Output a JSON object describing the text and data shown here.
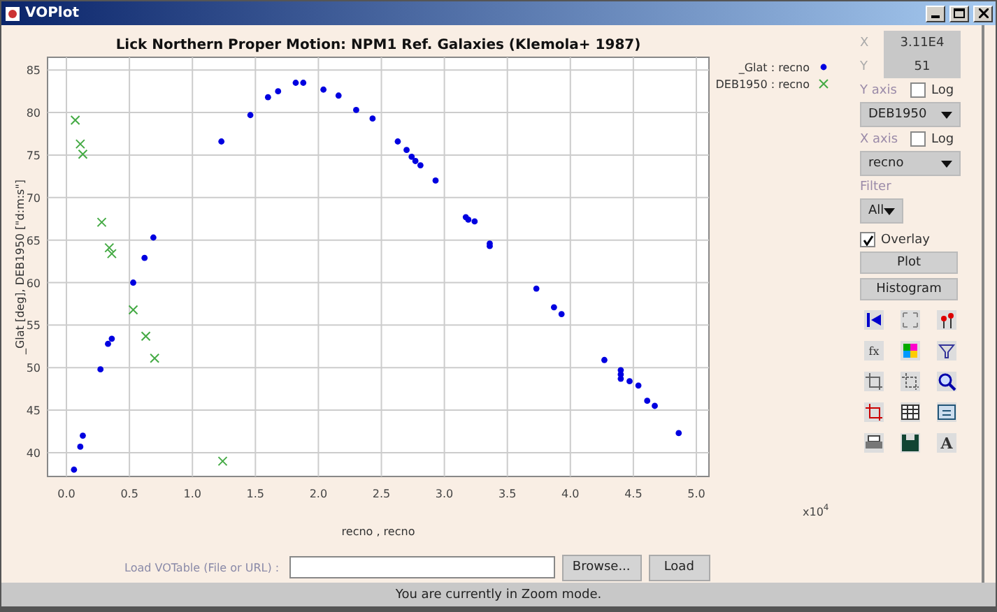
{
  "window": {
    "title": "VOPlot"
  },
  "chart": {
    "chart_data": {
      "type": "scatter",
      "title": "Lick Northern Proper Motion: NPM1 Ref. Galaxies (Klemola+ 1987)",
      "xlabel": "recno , recno",
      "ylabel": "_Glat [deg], DEB1950 [\"d:m:s\"]",
      "xlim": [
        -0.15,
        5.1
      ],
      "ylim": [
        37.2,
        86.5
      ],
      "grid": true,
      "legend": true,
      "xticks": [
        {
          "value": 0,
          "label": "0.0"
        },
        {
          "value": 0.5,
          "label": "0.5"
        },
        {
          "value": 1,
          "label": "1.0"
        },
        1.5,
        {
          "value": 2,
          "label": "2.0"
        },
        2.5,
        {
          "value": 3,
          "label": "3.0"
        },
        3.5,
        {
          "value": 4,
          "label": "4.0"
        },
        4.5,
        {
          "value": 5,
          "label": "5.0"
        }
      ],
      "yticks": [
        40,
        45,
        50,
        55,
        60,
        65,
        70,
        75,
        80,
        85
      ],
      "series": [
        {
          "name": "_Glat : recno",
          "color": "#0000e0",
          "x": [
            0.06,
            0.11,
            0.13,
            0.27,
            0.33,
            0.36,
            0.53,
            0.62,
            0.69,
            1.23,
            1.46,
            1.6,
            1.68,
            1.82,
            1.88,
            2.04,
            2.16,
            2.3,
            2.43,
            2.63,
            2.7,
            2.74,
            2.77,
            2.81,
            2.93,
            3.17,
            3.19,
            3.24,
            3.36,
            3.36,
            3.73,
            3.87,
            3.93,
            4.27,
            4.4,
            4.4,
            4.4,
            4.47,
            4.54,
            4.61,
            4.67,
            4.86
          ],
          "values": [
            38.0,
            40.7,
            42.0,
            49.8,
            52.8,
            53.4,
            60.0,
            62.9,
            65.3,
            76.6,
            79.7,
            81.8,
            82.5,
            83.5,
            83.5,
            82.7,
            82.0,
            80.3,
            79.3,
            76.6,
            75.6,
            74.8,
            74.3,
            73.8,
            72.0,
            67.7,
            67.4,
            67.2,
            64.6,
            64.3,
            59.3,
            57.1,
            56.3,
            50.9,
            49.7,
            49.2,
            48.7,
            48.4,
            47.9,
            46.1,
            45.5,
            42.3
          ]
        },
        {
          "name": "DEB1950 : recno",
          "color": "#44aa44",
          "x": [
            0.07,
            0.11,
            0.13,
            0.28,
            0.34,
            0.36,
            0.53,
            0.63,
            0.7,
            1.24
          ],
          "values": [
            79.1,
            76.3,
            75.1,
            67.1,
            64.1,
            63.4,
            56.8,
            53.7,
            51.1,
            39.0
          ]
        }
      ]
    },
    "x_multiplier": "x10",
    "x_exponent": "4"
  },
  "load": {
    "label": "Load VOTable (File or URL) :",
    "buttons": [
      "Browse...",
      "Load"
    ]
  },
  "controls": {
    "x_label": "X",
    "x_value": "3.11E4",
    "y_label": "Y",
    "y_value": "51",
    "y_axis": {
      "label": "Y axis",
      "log_label": "Log",
      "log": false,
      "value": "DEB1950"
    },
    "x_axis": {
      "label": "X axis",
      "log_label": "Log",
      "log": false,
      "value": "recno"
    },
    "filter": {
      "label": "Filter",
      "value": "All"
    },
    "overlay": {
      "label": "Overlay",
      "checked": true
    },
    "buttons": [
      "Plot",
      "Histogram"
    ],
    "tool_texts": [
      "fx",
      "A"
    ]
  },
  "status_bar": "You are currently in Zoom mode."
}
